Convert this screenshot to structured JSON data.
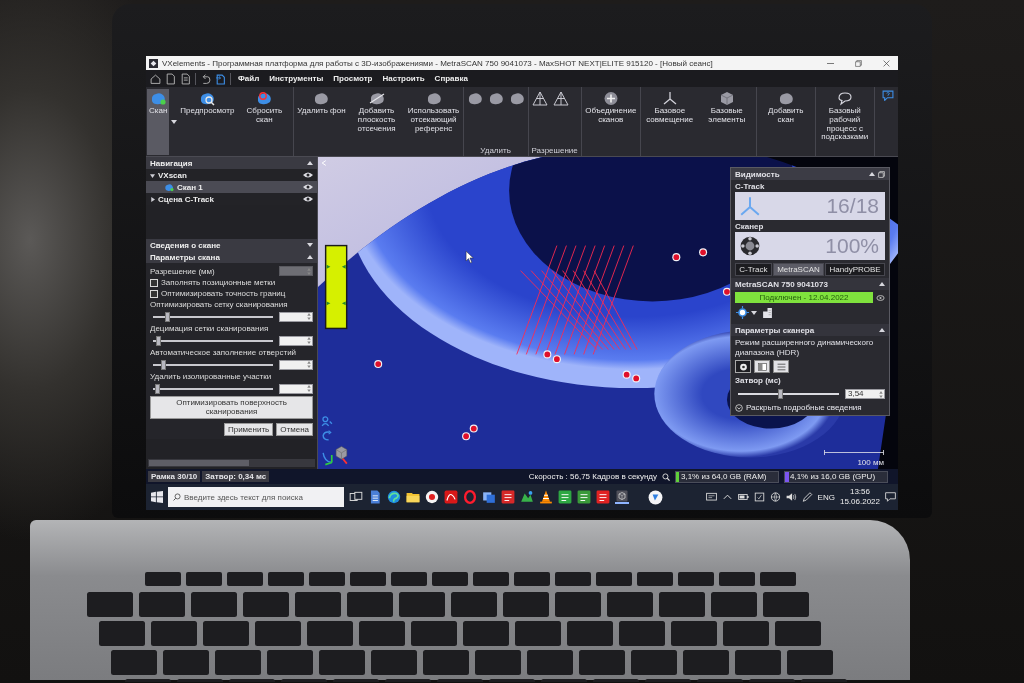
{
  "window": {
    "title": "VXelements - Программная платформа для работы с 3D-изображениями - MetraSCAN 750 9041073 - MaxSHOT NEXT|ELITE 915120 - [Новый сеанс]"
  },
  "menu": [
    {
      "label": "Файл"
    },
    {
      "label": "Инструменты"
    },
    {
      "label": "Просмотр"
    },
    {
      "label": "Настроить"
    },
    {
      "label": "Справка"
    }
  ],
  "ribbon": {
    "groups": [
      {
        "buttons": [
          {
            "label": "Скан",
            "on": true,
            "dropdown": true
          },
          {
            "label": "Предпросмотр",
            "on": false
          },
          {
            "label": "Сбросить скан",
            "on": false
          }
        ]
      },
      {
        "buttons": [
          {
            "label": "Удалить фон",
            "on": false
          },
          {
            "label": "Добавить плоскость отсечения",
            "on": false
          },
          {
            "label": "Использовать отсекающий референс",
            "on": false
          }
        ]
      },
      {
        "label": "Удалить",
        "buttons": [
          {
            "on": false
          },
          {
            "on": false
          },
          {
            "on": false
          }
        ]
      },
      {
        "label": "Разрешение",
        "buttons": [
          {
            "on": false
          },
          {
            "on": false
          }
        ]
      },
      {
        "buttons": [
          {
            "label": "Объединение сканов",
            "on": false
          }
        ]
      },
      {
        "buttons": [
          {
            "label": "Базовое совмещение",
            "on": false
          },
          {
            "label": "Базовые элементы",
            "on": false
          }
        ]
      },
      {
        "buttons": [
          {
            "label": "Добавить скан",
            "on": false
          }
        ]
      },
      {
        "buttons": [
          {
            "label": "Базовый рабочий процесс с подсказками",
            "on": false
          }
        ]
      }
    ]
  },
  "navigation": {
    "title": "Навигация",
    "expanded": true,
    "tree": [
      {
        "label": "VXscan",
        "expanded": true,
        "selected": false,
        "children": [
          {
            "label": "Скан 1",
            "selected": true
          }
        ]
      },
      {
        "label": "Сцена C-Track",
        "expanded": false,
        "selected": false
      }
    ]
  },
  "scan_info": {
    "title": "Сведения о скане",
    "expanded": false
  },
  "scan_params": {
    "title": "Параметры скана",
    "expanded": true,
    "resolution": {
      "label": "Разрешение (мм)",
      "disabled": true
    },
    "checkboxes": [
      {
        "label": "Заполнять позиционные метки",
        "checked": false
      },
      {
        "label": "Оптимизировать точность границ",
        "checked": false
      }
    ],
    "sliders": [
      {
        "label": "Оптимизировать сетку сканирования",
        "level": 0.12
      },
      {
        "label": "Децимация сетки сканирования",
        "level": 0.04
      },
      {
        "label": "Автоматическое заполнение отверстий",
        "level": 0.08
      },
      {
        "label": "Удалить изолированные участки",
        "level": 0.03
      }
    ],
    "optimize_button": "Оптимизировать поверхность сканирования",
    "actions": [
      "Применить",
      "Отмена"
    ]
  },
  "viewport": {
    "scale_label": "100 мм"
  },
  "visibility": {
    "title": "Видимость",
    "expanded": true,
    "readouts": [
      {
        "kind": "tracker",
        "label": "C-Track",
        "reading": "16/18"
      },
      {
        "kind": "scanner",
        "label": "Сканер",
        "reading": "100%"
      }
    ],
    "tabs": [
      {
        "label": "C-Track",
        "selected": false
      },
      {
        "label": "MetraSCAN",
        "selected": true
      },
      {
        "label": "HandyPROBE",
        "selected": false
      }
    ],
    "device": {
      "title": "MetraSCAN 750 9041073",
      "expanded": true,
      "status": "Подключен - 12.04.2022",
      "connected": true
    },
    "scanner_params": {
      "title": "Параметры сканера",
      "expanded": true,
      "hdr_label": "Режим расширенного динамического диапазона (HDR)",
      "modes": [
        {
          "selected": true
        },
        {
          "selected": false
        },
        {
          "selected": false
        }
      ],
      "shutter": {
        "label": "Затвор (мс)",
        "level": 0.42,
        "value": "3,54"
      }
    },
    "details_link": "Раскрыть подробные сведения"
  },
  "status_bar": {
    "items": [
      "Рамка 30/10",
      "Затвор: 0,34 мс"
    ],
    "speed": "Скорость : 56,75 Кадров в секунду",
    "memory": [
      {
        "text": "3,1% из 64,0 GB (RAM)",
        "level": 0.031,
        "color": "#5fd13a"
      },
      {
        "text": "4,1% из 16,0 GB (GPU)",
        "level": 0.041,
        "color": "#7b55f0"
      }
    ]
  },
  "taskbar": {
    "search": {
      "placeholder": "Введите здесь текст для поиска"
    },
    "language": "ENG",
    "time": "13:56",
    "date": "15.06.2022"
  }
}
